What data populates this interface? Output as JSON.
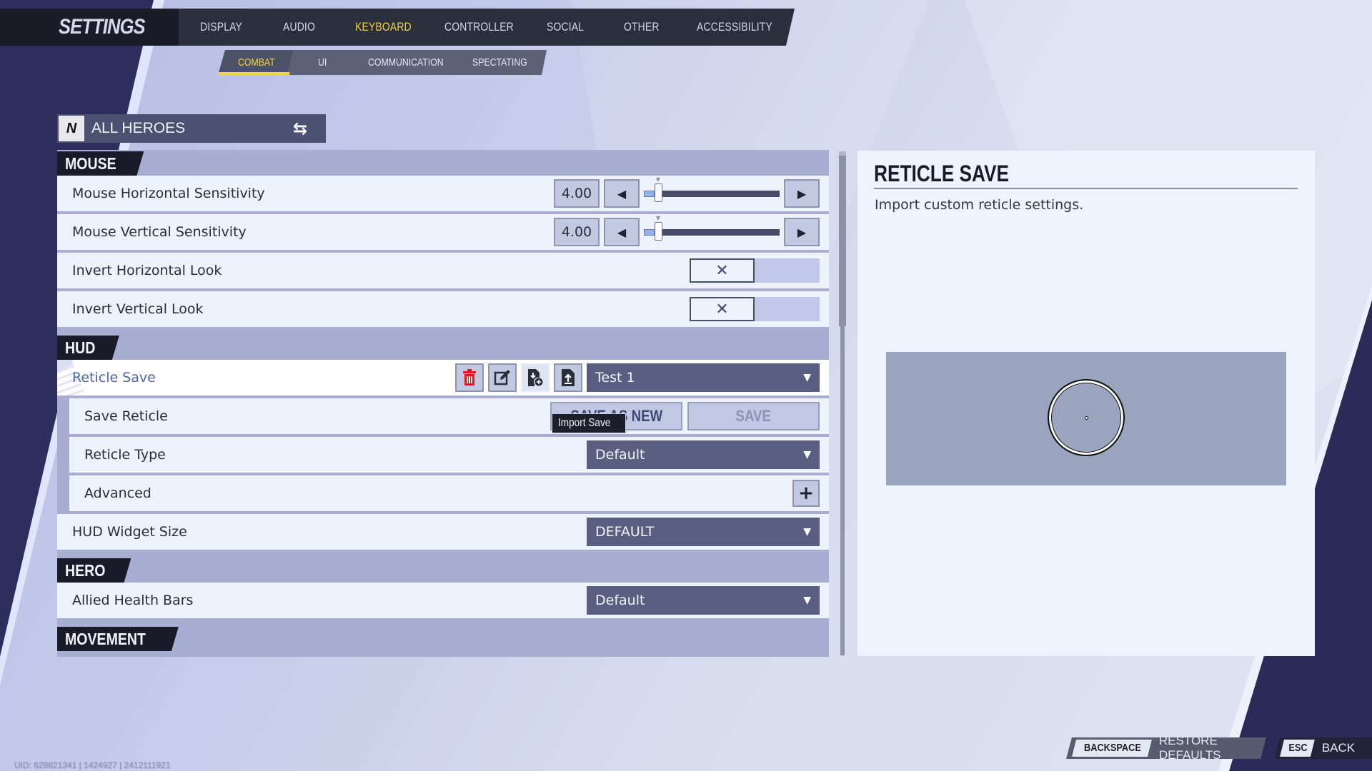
{
  "app": {
    "title": "SETTINGS",
    "tabs": [
      {
        "label": "DISPLAY",
        "active": false
      },
      {
        "label": "AUDIO",
        "active": false
      },
      {
        "label": "KEYBOARD",
        "active": true
      },
      {
        "label": "CONTROLLER",
        "active": false
      },
      {
        "label": "SOCIAL",
        "active": false
      },
      {
        "label": "OTHER",
        "active": false
      },
      {
        "label": "ACCESSIBILITY",
        "active": false
      }
    ],
    "subtabs": [
      {
        "label": "COMBAT",
        "active": true
      },
      {
        "label": "UI",
        "active": false
      },
      {
        "label": "COMMUNICATION",
        "active": false
      },
      {
        "label": "SPECTATING",
        "active": false
      }
    ],
    "accent_color": "#f3d340"
  },
  "hero_selector": {
    "label": "ALL HEROES",
    "icon": "hero-logo-icon",
    "swap_icon": "swap-arrows-icon"
  },
  "sections": {
    "mouse": {
      "title": "MOUSE",
      "horizontal_sensitivity": {
        "label": "Mouse Horizontal Sensitivity",
        "value": "4.00",
        "fraction": 0.08
      },
      "vertical_sensitivity": {
        "label": "Mouse Vertical Sensitivity",
        "value": "4.00",
        "fraction": 0.08
      },
      "invert_horizontal": {
        "label": "Invert Horizontal Look",
        "state": "off",
        "icon": "x-icon"
      },
      "invert_vertical": {
        "label": "Invert Vertical Look",
        "state": "off",
        "icon": "x-icon"
      }
    },
    "hud": {
      "title": "HUD",
      "reticle_save": {
        "label": "Reticle Save",
        "selected": "Test 1",
        "buttons": [
          "delete-icon",
          "edit-icon",
          "import-save-icon",
          "export-icon"
        ]
      },
      "save_reticle": {
        "label": "Save Reticle",
        "save_as_new": "SAVE AS NEW",
        "save": "SAVE"
      },
      "reticle_type": {
        "label": "Reticle Type",
        "value": "Default"
      },
      "advanced": {
        "label": "Advanced",
        "button": "+"
      },
      "hud_widget_size": {
        "label": "HUD Widget Size",
        "value": "DEFAULT"
      }
    },
    "hero": {
      "title": "HERO",
      "allied_health_bars": {
        "label": "Allied Health Bars",
        "value": "Default"
      }
    },
    "movement": {
      "title": "MOVEMENT"
    }
  },
  "tooltip": "Import Save",
  "detail": {
    "title": "RETICLE SAVE",
    "description": "Import custom reticle settings."
  },
  "footer": {
    "restore_key": "BACKSPACE",
    "restore_label": "RESTORE DEFAULTS",
    "back_key": "ESC",
    "back_label": "BACK",
    "uid": "UID: 628821341 | 1424927 | 2412111921"
  }
}
